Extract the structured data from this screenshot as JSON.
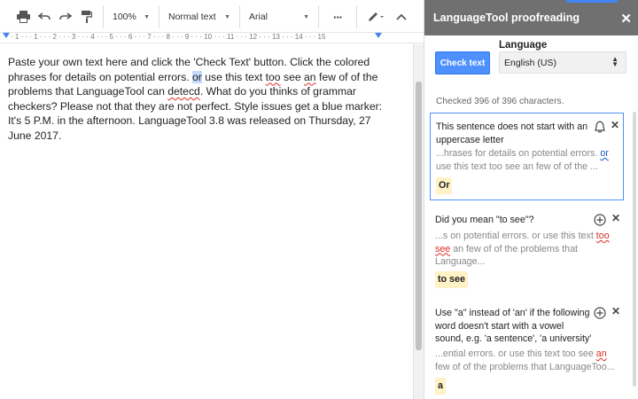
{
  "toolbar": {
    "zoom": "100%",
    "style": "Normal text",
    "font": "Arial",
    "more": "···"
  },
  "ruler": {
    "numbers": "· 1 · · · 1 · · · 2 · · · 3 · · · 4 · · · 5 · · · 6 · · · 7 · · · 8 · · · 9 · · · 10 · · · 11 · · · 12 · · · 13 · · · 14 · · · 15"
  },
  "document": {
    "p1_a": "Paste your own text here and click the 'Check Text' button. Click the colored phrases for details on potential errors. ",
    "p1_sel": "or",
    "p1_b": " use this text ",
    "p1_too": "too",
    "p1_c": " see ",
    "p1_an": "an",
    "p1_d": " few of of the problems that LanguageTool can ",
    "p1_detecd": "detecd",
    "p1_e": ". What do you thinks of grammar checkers? Please not that they are not perfect. Style issues get a blue marker: It's 5 P.M. in the afternoon. LanguageTool 3.8 was released on Thursday, 27 June 2017."
  },
  "sidebar": {
    "title": "LanguageTool proofreading",
    "language_label": "Language",
    "check_button": "Check text",
    "language_value": "English (US)",
    "checked_info": "Checked 396 of 396 characters.",
    "cards": [
      {
        "title": "This sentence does not start with an uppercase letter",
        "ctx_a": "...hrases for details on potential errors. ",
        "ctx_err": "or",
        "ctx_b": " use this text too see an few of of the ...",
        "suggestion": "Or"
      },
      {
        "title": "Did you mean \"to see\"?",
        "ctx_a": "...s on potential errors. or use this text ",
        "ctx_err": "too see",
        "ctx_b": " an few of of the problems that Language...",
        "suggestion": "to see"
      },
      {
        "title": "Use \"a\" instead of 'an' if the following word doesn't start with a vowel sound, e.g. 'a sentence', 'a university'",
        "ctx_a": "...ential errors. or use this text too see ",
        "ctx_err": "an",
        "ctx_b": " few of of the problems that LanguageToo...",
        "suggestion": "a"
      }
    ]
  },
  "colors": {
    "header_bg": "#707070",
    "accent_blue": "#4d90fe",
    "error_red": "#d93025",
    "style_blue": "#1155cc",
    "suggestion_bg": "#fff2c6"
  }
}
